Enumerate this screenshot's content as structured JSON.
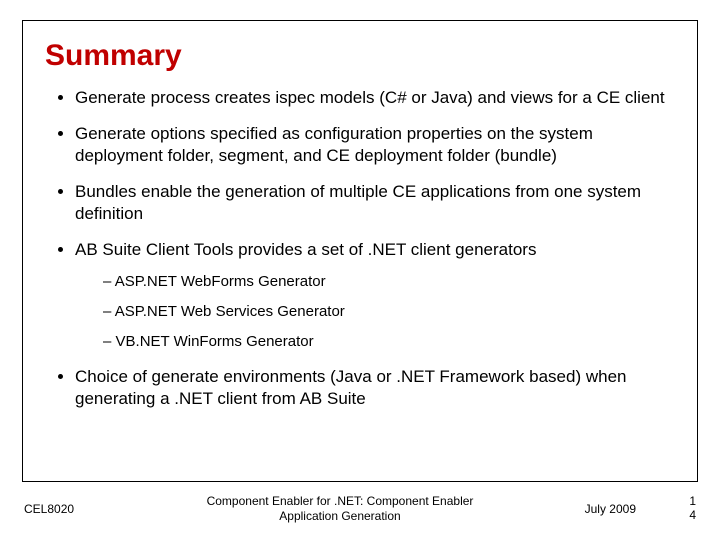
{
  "title": "Summary",
  "bullets": [
    {
      "text": "Generate process creates ispec models (C# or Java) and views for a CE client"
    },
    {
      "text": "Generate options specified as configuration properties on the system deployment folder, segment, and CE deployment folder (bundle)"
    },
    {
      "text": "Bundles enable the generation of multiple CE applications from one system definition"
    },
    {
      "text": "AB Suite Client Tools provides a set of .NET client generators",
      "sub": [
        "ASP.NET WebForms Generator",
        "ASP.NET Web Services Generator",
        "VB.NET WinForms Generator"
      ]
    },
    {
      "text": "Choice of generate environments (Java or .NET Framework based) when generating a .NET client from AB Suite"
    }
  ],
  "footer": {
    "left": "CEL8020",
    "center": "Component Enabler for .NET: Component Enabler Application Generation",
    "date": "July 2009",
    "page_top": "1",
    "page_bottom": "4"
  }
}
